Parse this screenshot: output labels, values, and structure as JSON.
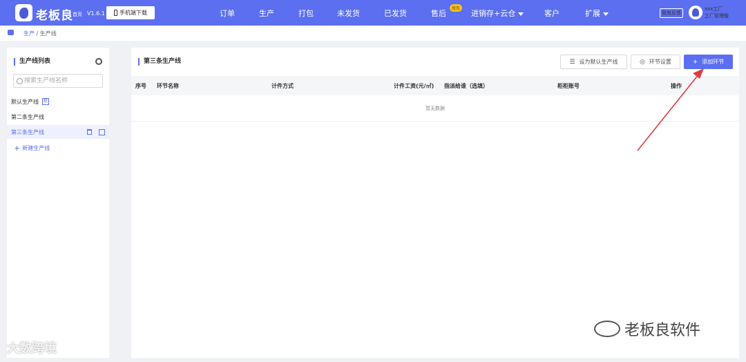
{
  "header": {
    "brand": "老板良",
    "brand_sub": "首页",
    "version": "V1.6.1",
    "mobile_download": "手机端下载",
    "nav": [
      {
        "label": "订单"
      },
      {
        "label": "生产"
      },
      {
        "label": "打包"
      },
      {
        "label": "未发货"
      },
      {
        "label": "已发货"
      },
      {
        "label": "售后"
      },
      {
        "label": "进销存+云仓"
      },
      {
        "label": "客户"
      },
      {
        "label": "扩展"
      }
    ],
    "new_badge": "抢先",
    "feedback": "我有反馈",
    "user": {
      "name": "xxx工厂",
      "role": "工厂管理版"
    }
  },
  "breadcrumb": {
    "parent": "生产",
    "separator": "/",
    "current": "生产线"
  },
  "sidebar": {
    "title": "生产线列表",
    "search_placeholder": "搜索生产线名称",
    "items": [
      {
        "label": "默认生产线",
        "tag": "默"
      },
      {
        "label": "第二条生产线"
      },
      {
        "label": "第三条生产线",
        "active": true
      }
    ],
    "new_line": "新建生产线"
  },
  "main": {
    "title": "第三条生产线",
    "buttons": {
      "set_default": "设为默认生产线",
      "step_settings": "环节设置",
      "add_step": "添加环节"
    },
    "columns": [
      "序号",
      "环节名称",
      "计件方式",
      "计件工资(元/㎡)",
      "指派给谁（选填）",
      "柜柜账号",
      "操作"
    ],
    "empty_text": "暂无数据"
  },
  "watermarks": {
    "left": "大数跨境",
    "right": "老板良软件"
  },
  "colors": {
    "primary": "#5b6ff0",
    "annotation": "#e03b3b"
  }
}
